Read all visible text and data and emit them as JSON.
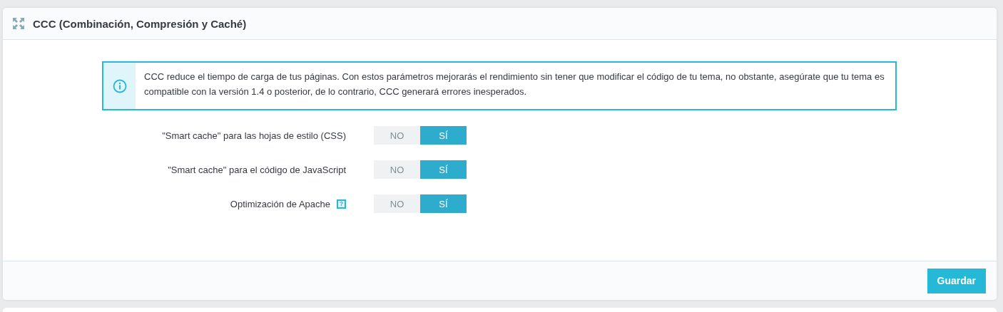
{
  "panel": {
    "title": "CCC (Combinación, Compresión y Caché)"
  },
  "alert": {
    "kind": "info",
    "text": "CCC reduce el tiempo de carga de tus páginas. Con estos parámetros mejorarás el rendimiento sin tener que modificar el código de tu tema, no obstante, asegúrate que tu tema es compatible con la versión 1.4 o posterior, de lo contrario, CCC generará errores inesperados."
  },
  "settings": [
    {
      "label": "\"Smart cache\" para las hojas de estilo (CSS)",
      "options": [
        {
          "label": "NO",
          "selected": false
        },
        {
          "label": "SÍ",
          "selected": true
        }
      ]
    },
    {
      "label": "\"Smart cache\" para el código de JavaScript",
      "options": [
        {
          "label": "NO",
          "selected": false
        },
        {
          "label": "SÍ",
          "selected": true
        }
      ]
    },
    {
      "label": "Optimización de Apache",
      "help": "?",
      "options": [
        {
          "label": "NO",
          "selected": false
        },
        {
          "label": "SÍ",
          "selected": true
        }
      ]
    }
  ],
  "save_button": "Guardar"
}
